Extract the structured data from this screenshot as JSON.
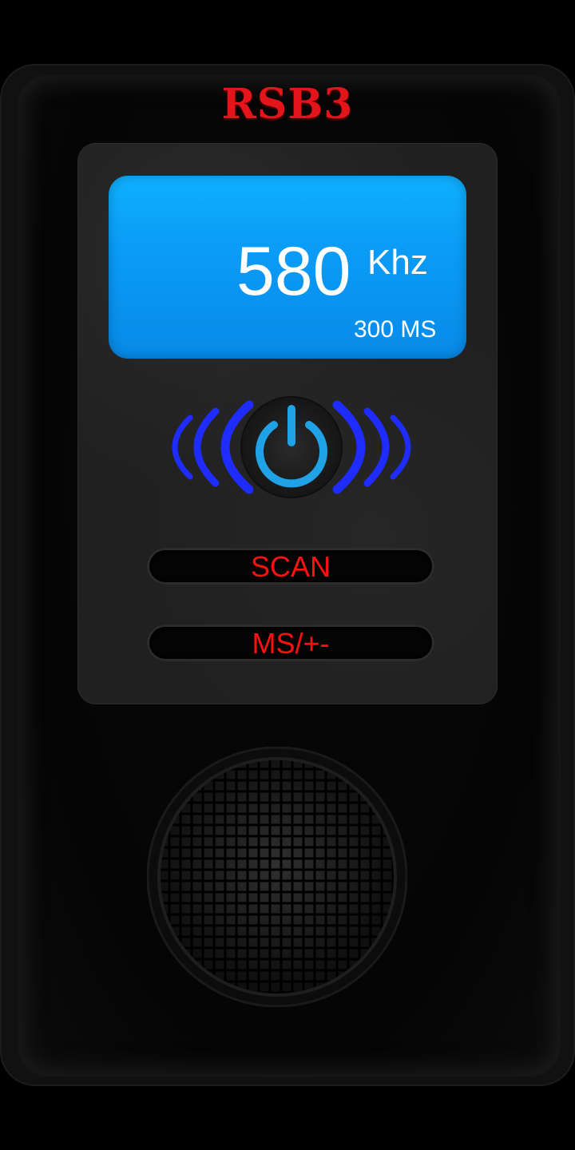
{
  "app": {
    "brand": "RSB3"
  },
  "display": {
    "frequency": "580",
    "unit": "Khz",
    "interval": "300 MS"
  },
  "controls": {
    "scan_label": "SCAN",
    "ms_label": "MS/+-"
  },
  "icons": {
    "power": "power-icon",
    "waves": "signal-waves-icon",
    "speaker": "speaker-grille-icon"
  },
  "colors": {
    "brand_red": "#e3141a",
    "lcd_blue": "#0aa0f8",
    "wave_blue": "#1e2cff",
    "power_ring": "#1fa3e6",
    "button_text_red": "#ff1010"
  }
}
